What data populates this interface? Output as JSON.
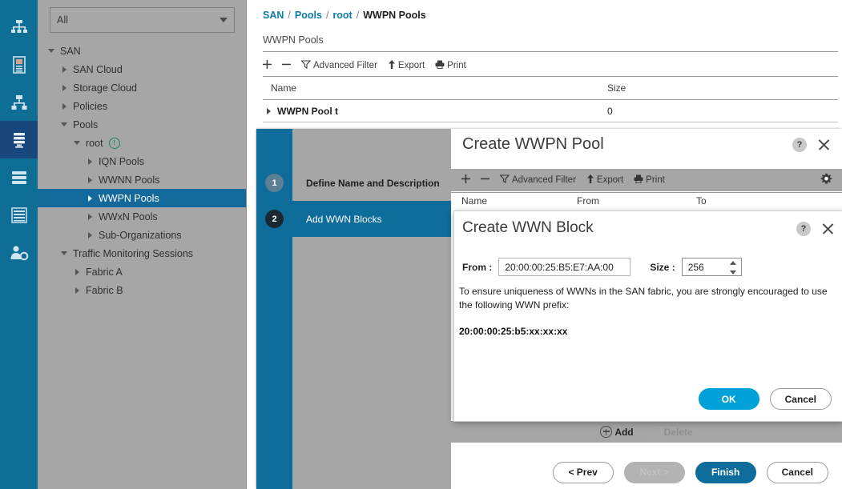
{
  "rail": {
    "items": [
      {
        "name": "equipment-icon",
        "active": false
      },
      {
        "name": "servers-icon",
        "active": false
      },
      {
        "name": "lan-icon",
        "active": false
      },
      {
        "name": "san-icon",
        "active": true
      },
      {
        "name": "vm-icon",
        "active": false
      },
      {
        "name": "storage-icon",
        "active": false
      },
      {
        "name": "admin-icon",
        "active": false
      }
    ]
  },
  "nav": {
    "filter": {
      "value": "All",
      "placeholder": "All"
    },
    "tree": [
      {
        "label": "SAN",
        "indent": 0,
        "twisty": "down",
        "selected": false
      },
      {
        "label": "SAN Cloud",
        "indent": 1,
        "twisty": "right",
        "selected": false
      },
      {
        "label": "Storage Cloud",
        "indent": 1,
        "twisty": "right",
        "selected": false
      },
      {
        "label": "Policies",
        "indent": 1,
        "twisty": "right",
        "selected": false
      },
      {
        "label": "Pools",
        "indent": 1,
        "twisty": "down",
        "selected": false
      },
      {
        "label": "root",
        "indent": 2,
        "twisty": "down",
        "selected": false,
        "badge": "!"
      },
      {
        "label": "IQN Pools",
        "indent": 3,
        "twisty": "right",
        "selected": false
      },
      {
        "label": "WWNN Pools",
        "indent": 3,
        "twisty": "right",
        "selected": false
      },
      {
        "label": "WWPN Pools",
        "indent": 3,
        "twisty": "right",
        "selected": true
      },
      {
        "label": "WWxN Pools",
        "indent": 3,
        "twisty": "right",
        "selected": false
      },
      {
        "label": "Sub-Organizations",
        "indent": 3,
        "twisty": "right",
        "selected": false
      },
      {
        "label": "Traffic Monitoring Sessions",
        "indent": 1,
        "twisty": "down",
        "selected": false
      },
      {
        "label": "Fabric A",
        "indent": 2,
        "twisty": "right",
        "selected": false
      },
      {
        "label": "Fabric B",
        "indent": 2,
        "twisty": "right",
        "selected": false
      }
    ]
  },
  "main": {
    "breadcrumb": {
      "links": [
        "SAN",
        "Pools",
        "root"
      ],
      "separator": "/",
      "current": "WWPN Pools"
    },
    "page_title": "WWPN Pools",
    "toolbar": {
      "add_label": "+",
      "remove_label": "–",
      "filter_label": "Advanced Filter",
      "export_label": "Export",
      "print_label": "Print"
    },
    "table": {
      "columns": [
        "Name",
        "Size"
      ],
      "rows": [
        {
          "name": "WWPN Pool t",
          "size": "0"
        }
      ]
    }
  },
  "wizard": {
    "title": "Create WWPN Pool",
    "help_label": "?",
    "steps": [
      {
        "number": "1",
        "label": "Define Name and Description",
        "state": "done"
      },
      {
        "number": "2",
        "label": "Add WWN Blocks",
        "state": "active"
      }
    ],
    "toolbar": {
      "add_label": "+",
      "remove_label": "–",
      "filter_label": "Advanced Filter",
      "export_label": "Export",
      "print_label": "Print",
      "settings_icon": "gear-icon"
    },
    "table": {
      "columns": [
        "Name",
        "From",
        "To"
      ],
      "rows": []
    },
    "actions": {
      "add_label": "Add",
      "delete_label": "Delete"
    },
    "buttons": {
      "prev": "< Prev",
      "next": "Next >",
      "finish": "Finish",
      "cancel": "Cancel"
    }
  },
  "wwn_dialog": {
    "title": "Create WWN Block",
    "help_label": "?",
    "from_label": "From :",
    "from_value": "20:00:00:25:B5:E7:AA:00",
    "size_label": "Size :",
    "size_value": "256",
    "note": "To ensure uniqueness of WWNs in the SAN fabric, you are strongly encouraged to use the following WWN prefix:",
    "prefix": "20:00:00:25:b5:xx:xx:xx",
    "ok_label": "OK",
    "cancel_label": "Cancel"
  },
  "colors": {
    "rail_blue": "#0f6e96",
    "rail_active": "#17477d",
    "accent_blue": "#0d6c99",
    "bright_blue": "#00a0d8",
    "selection_blue": "#12699a",
    "panel_gray": "#a6a6a6",
    "link_blue": "#0d7ca8",
    "badge_green": "#1d8a5e"
  }
}
